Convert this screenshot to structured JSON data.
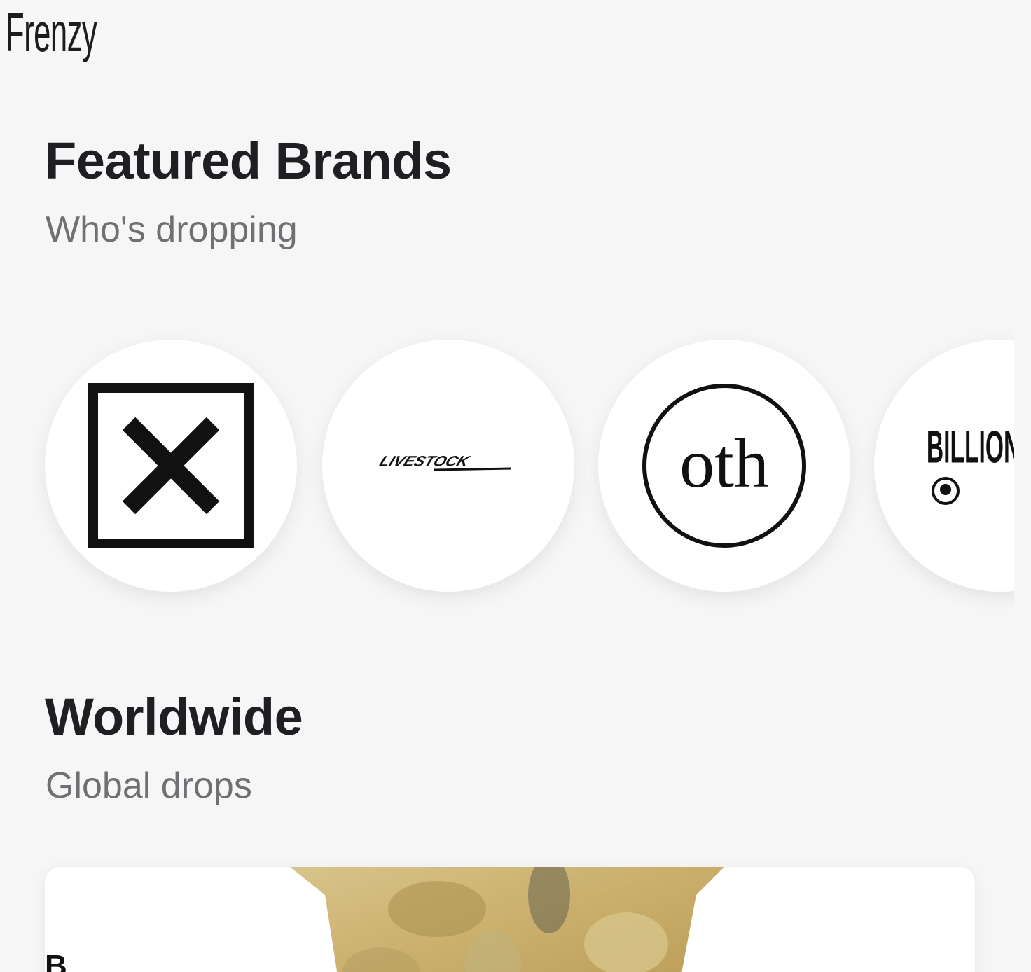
{
  "app": {
    "title": "Frenzy"
  },
  "featured": {
    "title": "Featured Brands",
    "subtitle": "Who's dropping",
    "brands": [
      {
        "name": "x-box-brand",
        "logo_text": ""
      },
      {
        "name": "livestock",
        "logo_text": "LIVESTOCK"
      },
      {
        "name": "oth",
        "logo_text": "oth"
      },
      {
        "name": "billionaire-boys-club",
        "logo_text": "BILLION BOYS"
      }
    ]
  },
  "worldwide": {
    "title": "Worldwide",
    "subtitle": "Global drops",
    "card": {
      "edge_text": "B"
    }
  },
  "colors": {
    "background": "#f7f7f7",
    "title": "#1e1e23",
    "subtitle": "#707074",
    "card": "#ffffff"
  }
}
